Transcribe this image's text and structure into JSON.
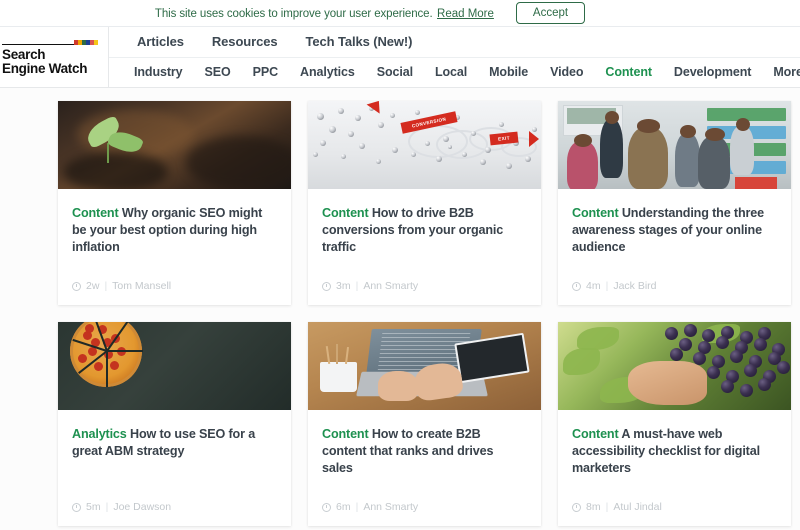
{
  "cookie_bar": {
    "text": "This site uses cookies to improve your user experience.",
    "read_more": "Read More",
    "accept_label": "Accept",
    "accent_color": "#2e6b47"
  },
  "logo": {
    "line1": "Search",
    "line2": "Engine Watch",
    "swatch_colors": [
      "#cf3a2e",
      "#f0a500",
      "#2e6b47",
      "#1c3f94",
      "#d9534f",
      "#f5c518"
    ]
  },
  "nav": {
    "primary": [
      {
        "label": "Articles",
        "active": false
      },
      {
        "label": "Resources",
        "active": false
      },
      {
        "label": "Tech Talks (New!)",
        "active": false
      }
    ],
    "secondary": [
      {
        "label": "Industry",
        "active": false
      },
      {
        "label": "SEO",
        "active": false
      },
      {
        "label": "PPC",
        "active": false
      },
      {
        "label": "Analytics",
        "active": false
      },
      {
        "label": "Social",
        "active": false
      },
      {
        "label": "Local",
        "active": false
      },
      {
        "label": "Mobile",
        "active": false
      },
      {
        "label": "Video",
        "active": false
      },
      {
        "label": "Content",
        "active": true
      },
      {
        "label": "Development",
        "active": false
      },
      {
        "label": "More",
        "active": false
      }
    ],
    "active_color": "#1e9150"
  },
  "articles": [
    {
      "category": "Content",
      "title": "Why organic SEO might be your best option during high inflation",
      "time": "2w",
      "separator": "|",
      "author": "Tom Mansell",
      "thumbnail": "seedling-in-soil"
    },
    {
      "category": "Content",
      "title": "How to drive B2B conversions from your organic traffic",
      "time": "3m",
      "separator": "|",
      "author": "Ann Smarty",
      "thumbnail": "conversion-funnel-balls",
      "thumb_labels": [
        "CONVERSION",
        "EXIT"
      ]
    },
    {
      "category": "Content",
      "title": "Understanding the three awareness stages of your online audience",
      "time": "4m",
      "separator": "|",
      "author": "Jack Bird",
      "thumbnail": "students-in-library"
    },
    {
      "category": "Analytics",
      "title": "How to use SEO for a great ABM strategy",
      "time": "5m",
      "separator": "|",
      "author": "Joe Dawson",
      "thumbnail": "pizza-pie-chart"
    },
    {
      "category": "Content",
      "title": "How to create B2B content that ranks and drives sales",
      "time": "6m",
      "separator": "|",
      "author": "Ann Smarty",
      "thumbnail": "laptop-hands-desk"
    },
    {
      "category": "Content",
      "title": "A must-have web accessibility checklist for digital marketers",
      "time": "8m",
      "separator": "|",
      "author": "Atul Jindal",
      "thumbnail": "hand-picking-grapes"
    }
  ]
}
